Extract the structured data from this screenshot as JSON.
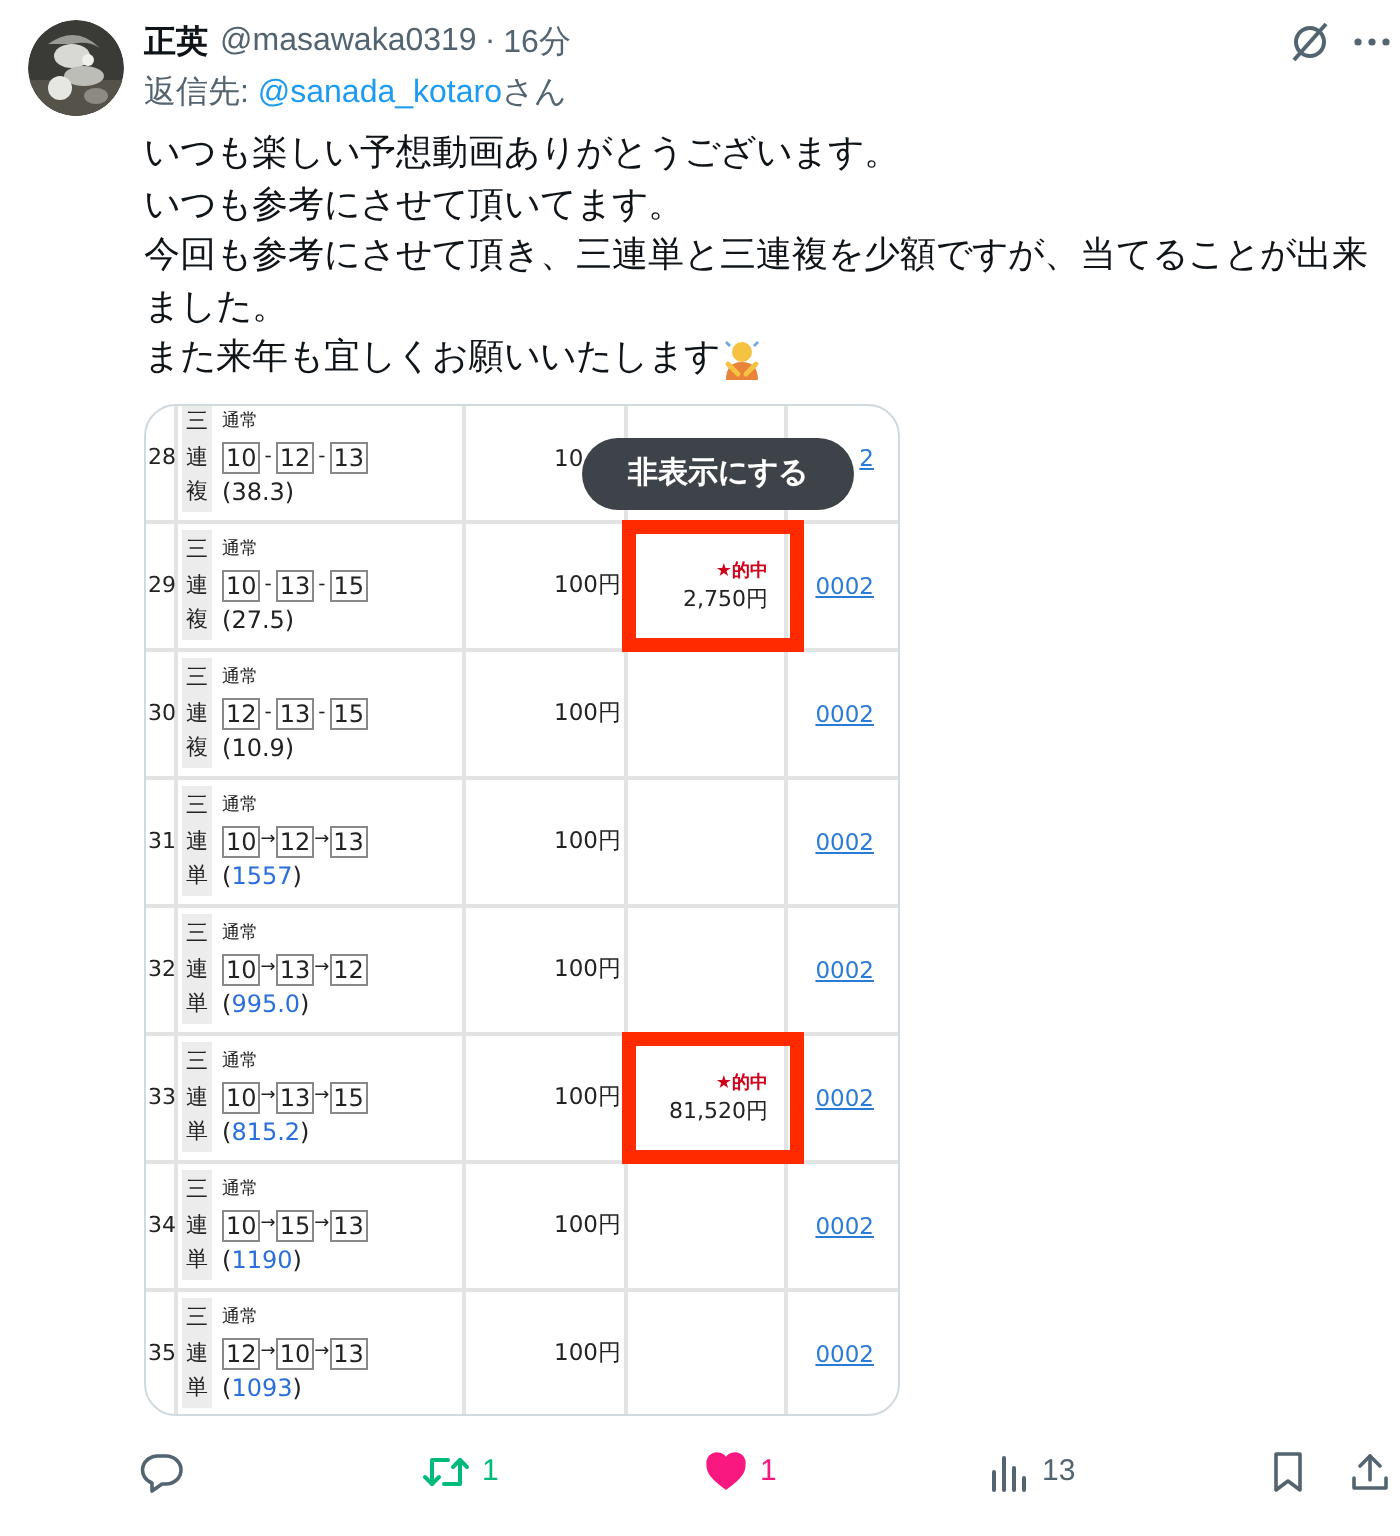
{
  "tweet": {
    "author": "正英",
    "handle": "@masawaka0319",
    "separator": "·",
    "time": "16分",
    "reply_to": {
      "prefix": "返信先: ",
      "user": "@sanada_kotaro",
      "suffix": "さん"
    },
    "paragraphs": [
      "いつも楽しい予想動画ありがとうございます。",
      "いつも参考にさせて頂いてます。",
      "今回も参考にさせて頂き、三連単と三連複を少額ですが、当てることが出来ました。",
      "また来年も宜しくお願いいたします"
    ],
    "media": {
      "tooltip": "非表示にする",
      "rows": [
        {
          "no": "28",
          "bet_type": "三連複",
          "mode": "通常",
          "numbers": [
            "10",
            "12",
            "13"
          ],
          "sep": "-",
          "odds": {
            "open": "(",
            "value": "38.3",
            "close": ")",
            "linked": false
          },
          "stake": "10",
          "link": "2"
        },
        {
          "no": "29",
          "bet_type": "三連複",
          "mode": "通常",
          "numbers": [
            "10",
            "13",
            "15"
          ],
          "sep": "-",
          "odds": {
            "open": "(",
            "value": "27.5",
            "close": ")",
            "linked": false
          },
          "stake": "100円",
          "hit": {
            "label": "★的中",
            "payout": "2,750円",
            "highlighted": true
          },
          "link": "0002"
        },
        {
          "no": "30",
          "bet_type": "三連複",
          "mode": "通常",
          "numbers": [
            "12",
            "13",
            "15"
          ],
          "sep": "-",
          "odds": {
            "open": "(",
            "value": "10.9",
            "close": ")",
            "linked": false
          },
          "stake": "100円",
          "link": "0002"
        },
        {
          "no": "31",
          "bet_type": "三連単",
          "mode": "通常",
          "numbers": [
            "10",
            "12",
            "13"
          ],
          "sep": "→",
          "odds": {
            "open": "(",
            "value": "1557",
            "close": ")",
            "linked": true
          },
          "stake": "100円",
          "link": "0002"
        },
        {
          "no": "32",
          "bet_type": "三連単",
          "mode": "通常",
          "numbers": [
            "10",
            "13",
            "12"
          ],
          "sep": "→",
          "odds": {
            "open": "(",
            "value": "995.0",
            "close": ")",
            "linked": true
          },
          "stake": "100円",
          "link": "0002"
        },
        {
          "no": "33",
          "bet_type": "三連単",
          "mode": "通常",
          "numbers": [
            "10",
            "13",
            "15"
          ],
          "sep": "→",
          "odds": {
            "open": "(",
            "value": "815.2",
            "close": ")",
            "linked": true
          },
          "stake": "100円",
          "hit": {
            "label": "★的中",
            "payout": "81,520円",
            "highlighted": true
          },
          "link": "0002"
        },
        {
          "no": "34",
          "bet_type": "三連単",
          "mode": "通常",
          "numbers": [
            "10",
            "15",
            "13"
          ],
          "sep": "→",
          "odds": {
            "open": "(",
            "value": "1190",
            "close": ")",
            "linked": true
          },
          "stake": "100円",
          "link": "0002"
        },
        {
          "no": "35",
          "bet_type": "三連単",
          "mode": "通常",
          "numbers": [
            "12",
            "10",
            "13"
          ],
          "sep": "→",
          "odds": {
            "open": "(",
            "value": "1093",
            "close": ")",
            "linked": true
          },
          "stake": "100円",
          "link": "0002"
        }
      ]
    },
    "actions": {
      "reposts": {
        "count": "1",
        "active": true
      },
      "likes": {
        "count": "1",
        "active": true
      },
      "views": {
        "count": "13"
      }
    }
  }
}
